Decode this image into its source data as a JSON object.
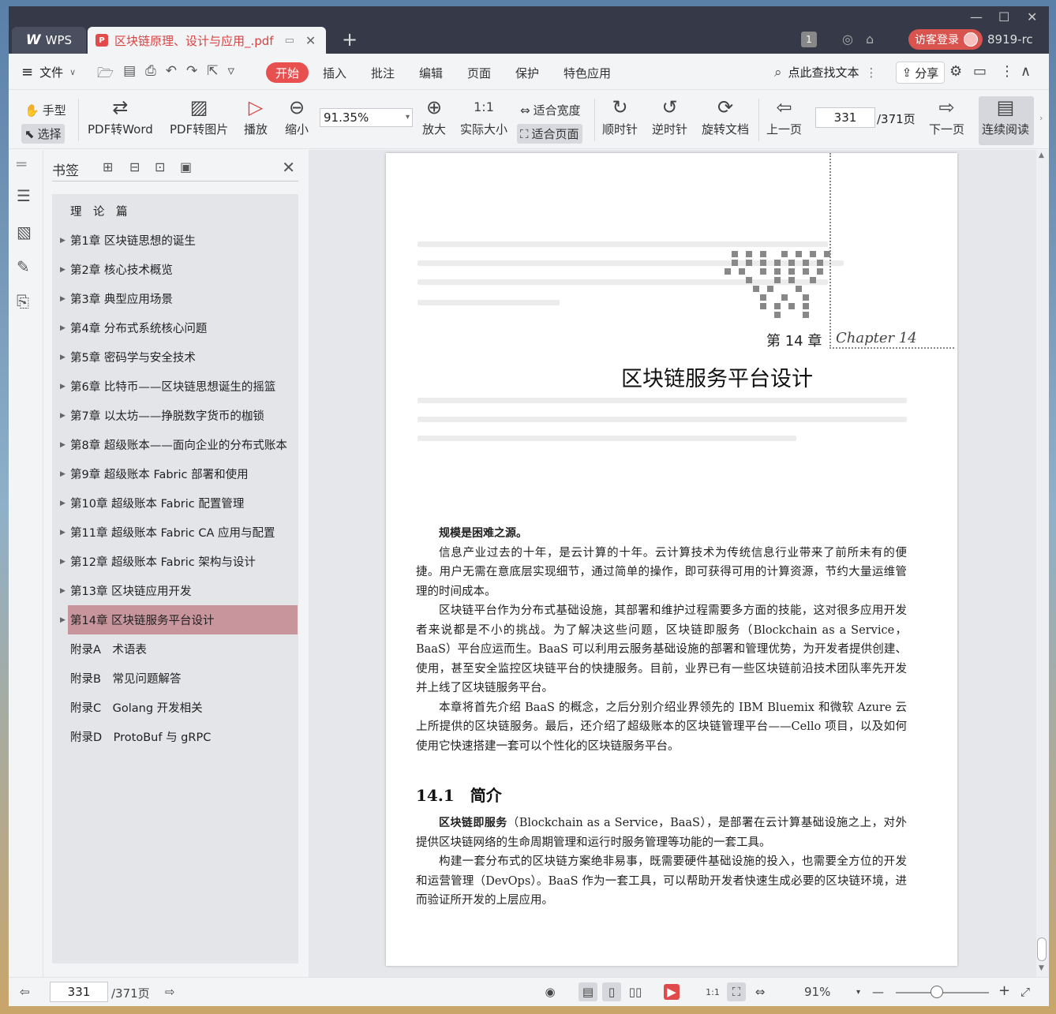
{
  "app": {
    "name": "WPS",
    "tab_title": "区块链原理、设计与应用_.pdf",
    "window_count": "1",
    "login_label": "访客登录",
    "user": "8919-rc"
  },
  "menu": {
    "file": "文件",
    "items": [
      "开始",
      "插入",
      "批注",
      "编辑",
      "页面",
      "保护",
      "特色应用"
    ],
    "search": "点此查找文本",
    "share": "分享"
  },
  "toolbar": {
    "hand": "手型",
    "select": "选择",
    "pdf_to_word": "PDF转Word",
    "pdf_to_image": "PDF转图片",
    "play": "播放",
    "zoom_out": "缩小",
    "zoom_value": "91.35%",
    "zoom_in": "放大",
    "actual_size": "实际大小",
    "fit_width": "适合宽度",
    "fit_page": "适合页面",
    "clockwise": "顺时针",
    "counterclockwise": "逆时针",
    "rotate_doc": "旋转文档",
    "prev_page": "上一页",
    "page_current": "331",
    "page_total": "/371页",
    "next_page": "下一页",
    "continuous": "连续阅读"
  },
  "bookmarks": {
    "title": "书签",
    "items": [
      {
        "label": "理　论　篇",
        "caret": false
      },
      {
        "label": "第1章 区块链思想的诞生",
        "caret": true
      },
      {
        "label": "第2章 核心技术概览",
        "caret": true
      },
      {
        "label": "第3章 典型应用场景",
        "caret": true
      },
      {
        "label": "第4章 分布式系统核心问题",
        "caret": true
      },
      {
        "label": "第5章 密码学与安全技术",
        "caret": true
      },
      {
        "label": "第6章 比特币——区块链思想诞生的摇篮",
        "caret": true
      },
      {
        "label": "第7章 以太坊——挣脱数字货币的枷锁",
        "caret": true
      },
      {
        "label": "第8章 超级账本——面向企业的分布式账本",
        "caret": true
      },
      {
        "label": "第9章 超级账本 Fabric 部署和使用",
        "caret": true
      },
      {
        "label": "第10章 超级账本 Fabric 配置管理",
        "caret": true
      },
      {
        "label": "第11章 超级账本 Fabric CA 应用与配置",
        "caret": true
      },
      {
        "label": "第12章 超级账本 Fabric 架构与设计",
        "caret": true
      },
      {
        "label": "第13章 区块链应用开发",
        "caret": true
      },
      {
        "label": "第14章 区块链服务平台设计",
        "caret": true,
        "active": true
      },
      {
        "label": "附录A　术语表",
        "caret": false
      },
      {
        "label": "附录B　常见问题解答",
        "caret": false
      },
      {
        "label": "附录C　Golang 开发相关",
        "caret": false
      },
      {
        "label": "附录D　ProtoBuf 与 gRPC",
        "caret": false
      }
    ]
  },
  "page": {
    "chapter_number": "第 14 章",
    "chapter_eng": "Chapter 14",
    "chapter_title": "区块链服务平台设计",
    "epigraph": "规模是困难之源。",
    "para1": "信息产业过去的十年，是云计算的十年。云计算技术为传统信息行业带来了前所未有的便捷。用户无需在意底层实现细节，通过简单的操作，即可获得可用的计算资源，节约大量运维管理的时间成本。",
    "para2": "区块链平台作为分布式基础设施，其部署和维护过程需要多方面的技能，这对很多应用开发者来说都是不小的挑战。为了解决这些问题，区块链即服务（Blockchain as a Service，BaaS）平台应运而生。BaaS 可以利用云服务基础设施的部署和管理优势，为开发者提供创建、使用，甚至安全监控区块链平台的快捷服务。目前，业界已有一些区块链前沿技术团队率先开发并上线了区块链服务平台。",
    "para3": "本章将首先介绍 BaaS 的概念，之后分别介绍业界领先的 IBM Bluemix 和微软 Azure 云上所提供的区块链服务。最后，还介绍了超级账本的区块链管理平台——Cello 项目，以及如何使用它快速搭建一套可以个性化的区块链服务平台。",
    "section_title": "14.1　简介",
    "para4_bold": "区块链即服务",
    "para4_rest": "（Blockchain as a Service，BaaS），是部署在云计算基础设施之上，对外提供区块链网络的生命周期管理和运行时服务管理等功能的一套工具。",
    "para5": "构建一套分布式的区块链方案绝非易事，既需要硬件基础设施的投入，也需要全方位的开发和运营管理（DevOps）。BaaS 作为一套工具，可以帮助开发者快速生成必要的区块链环境，进而验证所开发的上层应用。"
  },
  "statusbar": {
    "page_current": "331",
    "page_total": "/371页",
    "zoom": "91%"
  },
  "colors": {
    "accent": "#e85050",
    "titlebar": "#363a48",
    "bookmark_active": "#c8959c"
  }
}
